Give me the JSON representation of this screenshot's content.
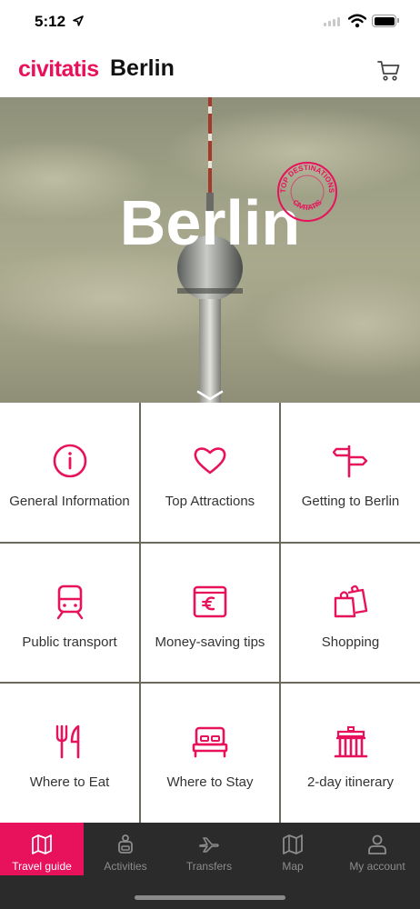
{
  "status_bar": {
    "time": "5:12"
  },
  "header": {
    "brand": "civitatis",
    "city": "Berlin"
  },
  "hero": {
    "title": "Berlin",
    "stamp_top": "TOP DESTINATIONS",
    "stamp_bottom": "CIVITATIS"
  },
  "grid": {
    "tiles": [
      {
        "label": "General Information",
        "icon": "info-icon"
      },
      {
        "label": "Top Attractions",
        "icon": "heart-icon"
      },
      {
        "label": "Getting to Berlin",
        "icon": "signpost-icon"
      },
      {
        "label": "Public transport",
        "icon": "train-icon"
      },
      {
        "label": "Money-saving tips",
        "icon": "euro-wallet-icon"
      },
      {
        "label": "Shopping",
        "icon": "shopping-bags-icon"
      },
      {
        "label": "Where to Eat",
        "icon": "fork-knife-icon"
      },
      {
        "label": "Where to Stay",
        "icon": "bed-icon"
      },
      {
        "label": "2-day itinerary",
        "icon": "brandenburg-gate-icon"
      }
    ]
  },
  "bottom_nav": {
    "items": [
      {
        "label": "Travel guide",
        "icon": "map-book-icon",
        "active": true
      },
      {
        "label": "Activities",
        "icon": "backpack-icon",
        "active": false
      },
      {
        "label": "Transfers",
        "icon": "plane-icon",
        "active": false
      },
      {
        "label": "Map",
        "icon": "map-icon",
        "active": false
      },
      {
        "label": "My account",
        "icon": "user-icon",
        "active": false
      }
    ]
  },
  "colors": {
    "accent": "#e8115b",
    "nav_bg": "#2b2b2b",
    "nav_label": "#8c8c8c"
  }
}
